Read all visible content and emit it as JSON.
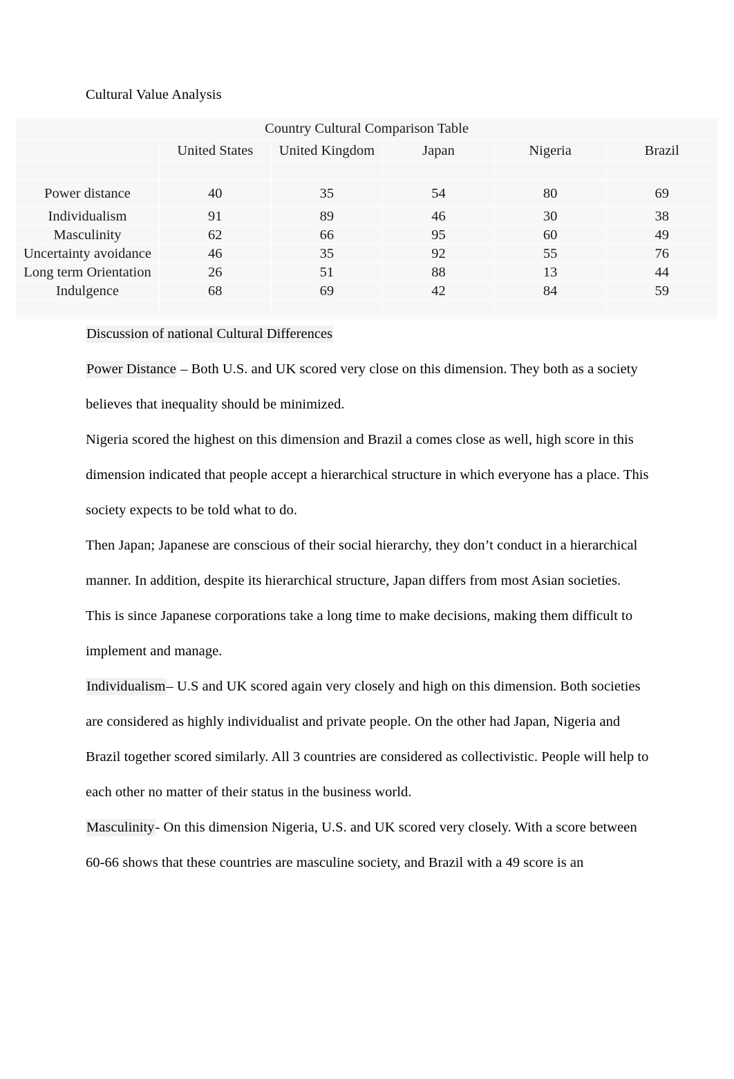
{
  "document": {
    "title": "Cultural Value Analysis"
  },
  "table": {
    "caption": "Country Cultural Comparison Table",
    "row_header_label": "",
    "columns": [
      "United States",
      "United Kingdom",
      "Japan",
      "Nigeria",
      "Brazil"
    ],
    "rows": [
      {
        "label": "Power distance",
        "values": [
          "40",
          "35",
          "54",
          "80",
          "69"
        ]
      },
      {
        "label": "Individualism",
        "values": [
          "91",
          "89",
          "46",
          "30",
          "38"
        ]
      },
      {
        "label": "Masculinity",
        "values": [
          "62",
          "66",
          "95",
          "60",
          "49"
        ]
      },
      {
        "label": "Uncertainty avoidance",
        "values": [
          "46",
          "35",
          "92",
          "55",
          "76"
        ]
      },
      {
        "label": "Long term Orientation",
        "values": [
          "26",
          "51",
          "88",
          "13",
          "44"
        ]
      },
      {
        "label": "Indulgence",
        "values": [
          "68",
          "69",
          "42",
          "84",
          "59"
        ]
      }
    ]
  },
  "discussion": {
    "heading": "Discussion of national Cultural Differences",
    "paragraphs": [
      {
        "lead": "Power Distance",
        "rest": " – Both U.S. and UK scored very close on this dimension. They both as a society believes that inequality should be minimized."
      },
      {
        "lead": "",
        "rest": "Nigeria scored the highest on this dimension and Brazil a comes close as well, high score in this dimension indicated that people accept a hierarchical structure in which everyone has a place. This society expects to be told what to do."
      },
      {
        "lead": "",
        "rest": "Then Japan; Japanese are conscious of their social hierarchy, they don’t conduct in a hierarchical manner. In addition, despite its hierarchical structure, Japan differs from most Asian societies."
      },
      {
        "lead": "",
        "rest": "This is since Japanese corporations take a long time to make decisions, making them difficult to implement and manage."
      },
      {
        "lead": "Individualism",
        "rest": "– U.S and UK scored again very closely and high on this dimension. Both societies are considered as highly individualist and private people. On the other had Japan, Nigeria and Brazil together scored similarly. All 3 countries are considered as collectivistic. People will help to each other no matter of their status in the business world."
      },
      {
        "lead": "Masculinity",
        "rest": "- On this dimension Nigeria, U.S. and UK scored very closely. With a score between 60-66 shows that these countries are masculine society, and Brazil with a 49 score is an"
      }
    ]
  }
}
